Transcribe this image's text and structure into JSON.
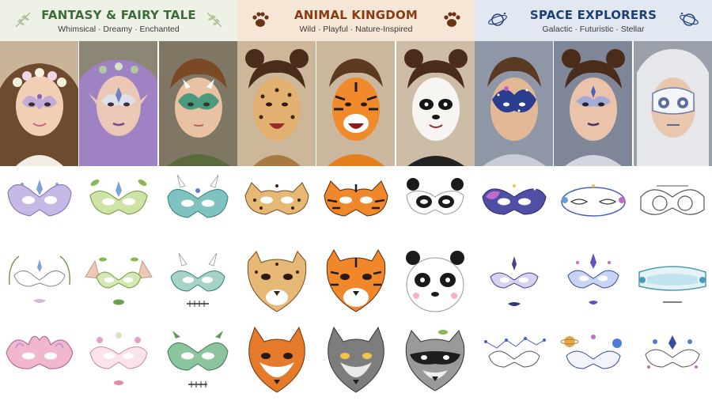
{
  "themes": [
    {
      "title": "FANTASY & FAIRY TALE",
      "subtitle": "Whimsical · Dreamy · Enchanted",
      "title_color": "#3f6b3a",
      "icon": "leaf-sprig-icon",
      "photos": [
        "flower-crown-girl-photo",
        "purple-elf-girl-photo",
        "green-dragon-boy-photo"
      ],
      "designs": [
        "lavender-butterfly-mask",
        "green-leaf-mask",
        "teal-dragon-mask",
        "white-vine-mask",
        "elf-ear-leaf-mask",
        "horned-dragon-mask",
        "pink-lotus-mask",
        "pink-flower-mask",
        "green-dragon-scale-mask"
      ]
    },
    {
      "title": "ANIMAL KINGDOM",
      "subtitle": "Wild · Playful · Nature-Inspired",
      "title_color": "#8a3a12",
      "icon": "paw-print-icon",
      "photos": [
        "leopard-girl-photo",
        "tiger-boy-photo",
        "panda-girl-photo"
      ],
      "designs": [
        "leopard-mask",
        "tiger-mask",
        "panda-mask",
        "leopard-face",
        "tiger-face",
        "panda-face",
        "fox-face",
        "wolf-face",
        "raccoon-face"
      ]
    },
    {
      "title": "SPACE EXPLORERS",
      "subtitle": "Galactic · Futuristic · Stellar",
      "title_color": "#1f3f78",
      "icon": "planet-icon",
      "photos": [
        "galaxy-boy-photo",
        "star-girl-photo",
        "robot-boy-photo"
      ],
      "designs": [
        "galaxy-mask",
        "orbit-mask",
        "robot-goggle-mask",
        "star-crown-mask",
        "cosmic-crown-mask",
        "visor-mask",
        "constellation-mask",
        "planet-orbit-mask",
        "cosmic-gem-mask"
      ]
    }
  ]
}
